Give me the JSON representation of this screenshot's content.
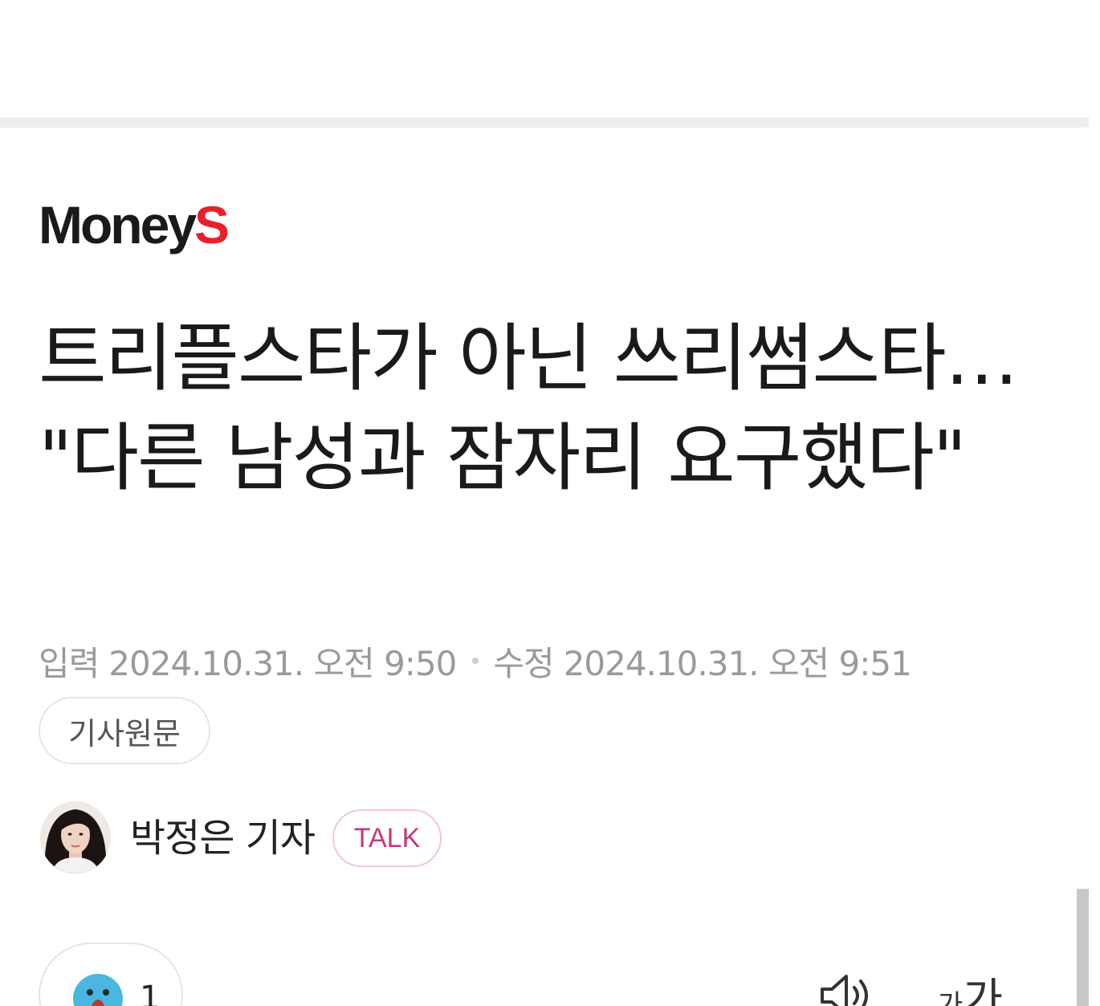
{
  "publisher": {
    "logo_main": "Money",
    "logo_accent": "S",
    "accent_color": "#e8202a"
  },
  "article": {
    "headline": "트리플스타가 아닌 쓰리썸스타… \"다른 남성과 잠자리 요구했다\"",
    "published_label": "입력",
    "published_at": "2024.10.31. 오전 9:50",
    "modified_label": "수정",
    "modified_at": "2024.10.31. 오전 9:51",
    "original_link_label": "기사원문"
  },
  "reporter": {
    "name": "박정은 기자",
    "talk_label": "TALK"
  },
  "toolbar": {
    "reaction_icon": "surprised-face-icon",
    "reaction_count": "1",
    "tts_icon": "speaker-icon",
    "font_size_small": "가",
    "font_size_big": "가"
  }
}
